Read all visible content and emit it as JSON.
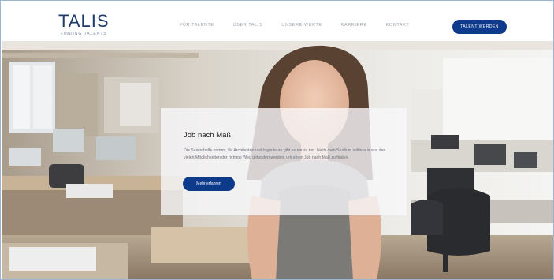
{
  "header": {
    "logo": {
      "wordmark": "TALIS",
      "tagline": "FINDING TALENTS"
    },
    "nav": [
      {
        "label": "Für Talente"
      },
      {
        "label": "Über TALIS"
      },
      {
        "label": "Unsere Werte"
      },
      {
        "label": "Karriere"
      },
      {
        "label": "Kontakt"
      }
    ],
    "cta_label": "Talent werden"
  },
  "hero": {
    "title": "Job nach Maß",
    "text": "Die Saisonhelfe kommt, für Architekten und Ingenieure gibt es nie zu tun. Nach dem Studium sollte aus aus den vielen Möglichkeiten der richtige Weg gefunden werden, um einen Job nach Maß zu finden.",
    "button_label": "Mehr erfahren"
  },
  "colors": {
    "brand": "#0d3a8a",
    "logo": "#1f3a6d"
  }
}
